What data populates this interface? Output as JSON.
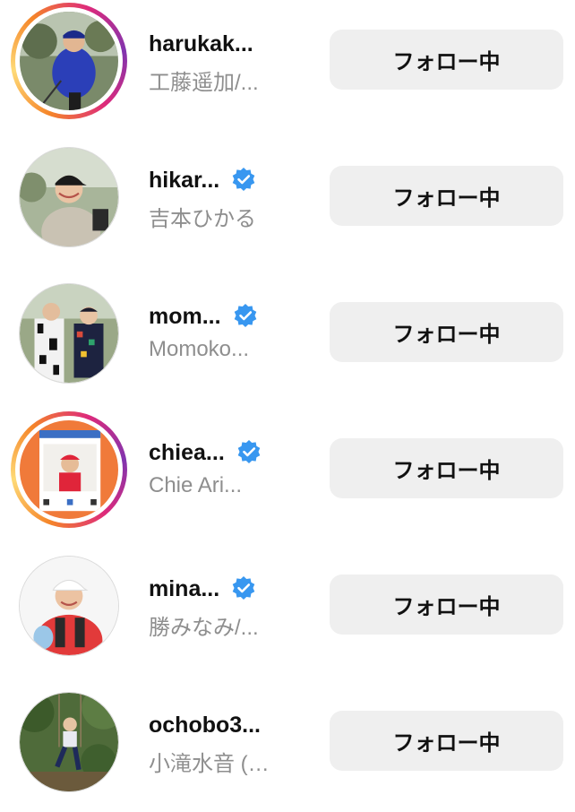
{
  "accounts": [
    {
      "username": "harukak...",
      "fullname": "工藤遥加/...",
      "verified": false,
      "story": true,
      "button": "フォロー中",
      "avatar_icon": "golfer-swing-photo"
    },
    {
      "username": "hikar...",
      "fullname": "吉本ひかる",
      "verified": true,
      "story": false,
      "button": "フォロー中",
      "avatar_icon": "golfer-smile-photo"
    },
    {
      "username": "mom...",
      "fullname": "Momoko...",
      "verified": true,
      "story": false,
      "button": "フォロー中",
      "avatar_icon": "two-golfers-photo"
    },
    {
      "username": "chiea...",
      "fullname": "Chie Ari...",
      "verified": true,
      "story": true,
      "button": "フォロー中",
      "avatar_icon": "instagram-frame-photo"
    },
    {
      "username": "mina...",
      "fullname": "勝みなみ/...",
      "verified": true,
      "story": false,
      "button": "フォロー中",
      "avatar_icon": "golfer-bag-photo"
    },
    {
      "username": "ochobo3...",
      "fullname": "小滝水音 (…",
      "verified": false,
      "story": false,
      "button": "フォロー中",
      "avatar_icon": "swing-garden-photo"
    }
  ],
  "colors": {
    "verified_badge": "#3897f0",
    "button_bg": "#efefef",
    "secondary_text": "#8e8e8e"
  }
}
